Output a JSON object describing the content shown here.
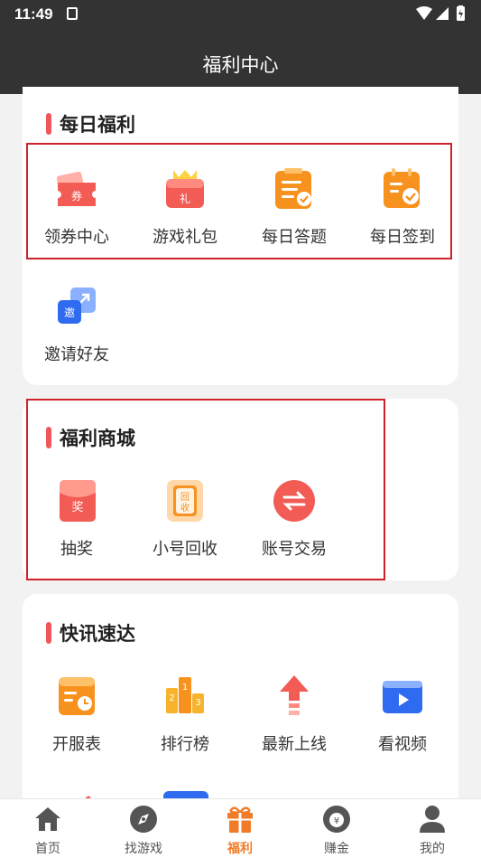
{
  "status": {
    "time": "11:49"
  },
  "header": {
    "title": "福利中心"
  },
  "daily": {
    "title": "每日福利",
    "items": [
      {
        "label": "领券中心",
        "icon": "coupon-icon"
      },
      {
        "label": "游戏礼包",
        "icon": "gift-pack-icon"
      },
      {
        "label": "每日答题",
        "icon": "quiz-icon"
      },
      {
        "label": "每日签到",
        "icon": "checkin-icon"
      },
      {
        "label": "邀请好友",
        "icon": "invite-icon"
      }
    ]
  },
  "mall": {
    "title": "福利商城",
    "items": [
      {
        "label": "抽奖",
        "icon": "lottery-icon"
      },
      {
        "label": "小号回收",
        "icon": "recycle-icon"
      },
      {
        "label": "账号交易",
        "icon": "trade-icon"
      }
    ]
  },
  "news": {
    "title": "快讯速达",
    "items": [
      {
        "label": "开服表",
        "icon": "server-schedule-icon"
      },
      {
        "label": "排行榜",
        "icon": "ranking-icon"
      },
      {
        "label": "最新上线",
        "icon": "new-release-icon"
      },
      {
        "label": "看视频",
        "icon": "video-icon"
      }
    ]
  },
  "tabs": [
    {
      "label": "首页",
      "icon": "home-icon"
    },
    {
      "label": "找游戏",
      "icon": "compass-icon"
    },
    {
      "label": "福利",
      "icon": "gift-icon",
      "active": true
    },
    {
      "label": "赚金",
      "icon": "money-bag-icon"
    },
    {
      "label": "我的",
      "icon": "user-icon"
    }
  ],
  "colors": {
    "accent": "#f07c2a",
    "red": "#f0575a",
    "header_bg": "#333333",
    "highlight": "#d0222b"
  }
}
